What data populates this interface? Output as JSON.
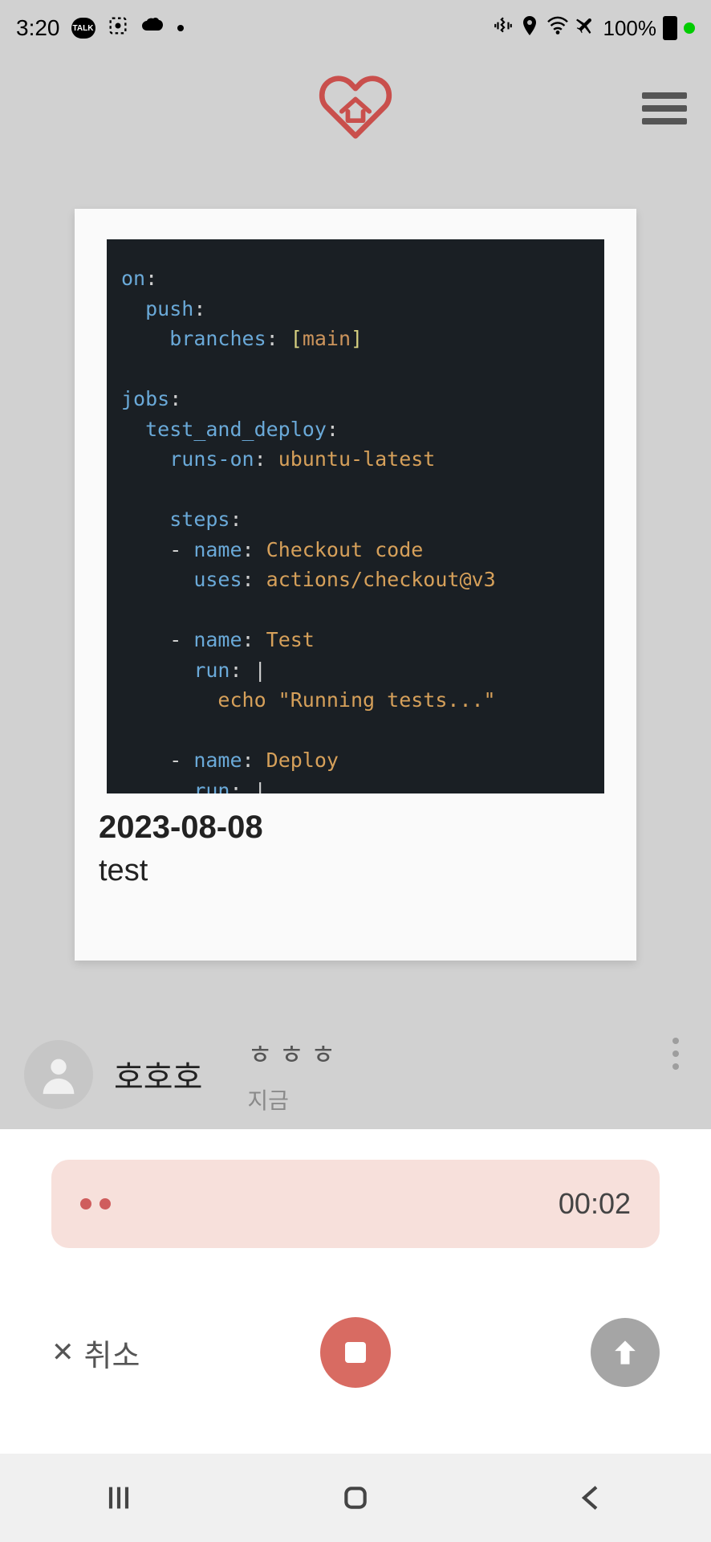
{
  "status": {
    "time": "3:20",
    "talk_label": "TALK",
    "battery": "100%"
  },
  "header": {
    "logo_color": "#c94f4c"
  },
  "card": {
    "code_lines": [
      {
        "segs": [
          {
            "t": "on",
            "c": "k"
          },
          {
            "t": ":",
            "c": "p"
          }
        ]
      },
      {
        "segs": [
          {
            "t": "  ",
            "c": "guide"
          },
          {
            "t": "push",
            "c": "k"
          },
          {
            "t": ":",
            "c": "p"
          }
        ]
      },
      {
        "segs": [
          {
            "t": "    ",
            "c": "guide"
          },
          {
            "t": "branches",
            "c": "k"
          },
          {
            "t": ": ",
            "c": "p"
          },
          {
            "t": "[",
            "c": "y"
          },
          {
            "t": "main",
            "c": "b"
          },
          {
            "t": "]",
            "c": "y"
          }
        ]
      },
      {
        "segs": [
          {
            "t": "",
            "c": "p"
          }
        ]
      },
      {
        "segs": [
          {
            "t": "jobs",
            "c": "k"
          },
          {
            "t": ":",
            "c": "p"
          }
        ]
      },
      {
        "segs": [
          {
            "t": "  ",
            "c": "guide"
          },
          {
            "t": "test_and_deploy",
            "c": "k"
          },
          {
            "t": ":",
            "c": "p"
          }
        ]
      },
      {
        "segs": [
          {
            "t": "    ",
            "c": "guide"
          },
          {
            "t": "runs-on",
            "c": "k"
          },
          {
            "t": ": ",
            "c": "p"
          },
          {
            "t": "ubuntu-latest",
            "c": "s"
          }
        ]
      },
      {
        "segs": [
          {
            "t": "",
            "c": "p"
          }
        ]
      },
      {
        "segs": [
          {
            "t": "    ",
            "c": "guide"
          },
          {
            "t": "steps",
            "c": "k"
          },
          {
            "t": ":",
            "c": "p"
          }
        ]
      },
      {
        "segs": [
          {
            "t": "    ",
            "c": "guide"
          },
          {
            "t": "- ",
            "c": "p"
          },
          {
            "t": "name",
            "c": "k"
          },
          {
            "t": ": ",
            "c": "p"
          },
          {
            "t": "Checkout code",
            "c": "s"
          }
        ]
      },
      {
        "segs": [
          {
            "t": "      ",
            "c": "guide"
          },
          {
            "t": "uses",
            "c": "k"
          },
          {
            "t": ": ",
            "c": "p"
          },
          {
            "t": "actions/checkout@v3",
            "c": "s"
          }
        ]
      },
      {
        "segs": [
          {
            "t": "",
            "c": "p"
          }
        ]
      },
      {
        "segs": [
          {
            "t": "    ",
            "c": "guide"
          },
          {
            "t": "- ",
            "c": "p"
          },
          {
            "t": "name",
            "c": "k"
          },
          {
            "t": ": ",
            "c": "p"
          },
          {
            "t": "Test",
            "c": "s"
          }
        ]
      },
      {
        "segs": [
          {
            "t": "      ",
            "c": "guide"
          },
          {
            "t": "run",
            "c": "k"
          },
          {
            "t": ": ",
            "c": "p"
          },
          {
            "t": "|",
            "c": "p"
          }
        ]
      },
      {
        "segs": [
          {
            "t": "        ",
            "c": "guide"
          },
          {
            "t": "echo \"Running tests...\"",
            "c": "s"
          }
        ]
      },
      {
        "segs": [
          {
            "t": "",
            "c": "p"
          }
        ]
      },
      {
        "segs": [
          {
            "t": "    ",
            "c": "guide"
          },
          {
            "t": "- ",
            "c": "p"
          },
          {
            "t": "name",
            "c": "k"
          },
          {
            "t": ": ",
            "c": "p"
          },
          {
            "t": "Deploy",
            "c": "s"
          }
        ]
      },
      {
        "segs": [
          {
            "t": "      ",
            "c": "guide"
          },
          {
            "t": "run",
            "c": "k"
          },
          {
            "t": ": ",
            "c": "p"
          },
          {
            "t": "|",
            "c": "p"
          }
        ]
      }
    ],
    "date": "2023-08-08",
    "title": "test"
  },
  "comment": {
    "name": "호호호",
    "text": "ㅎㅎㅎ",
    "time": "지금"
  },
  "recorder": {
    "timer": "00:02",
    "cancel_label": "취소"
  }
}
